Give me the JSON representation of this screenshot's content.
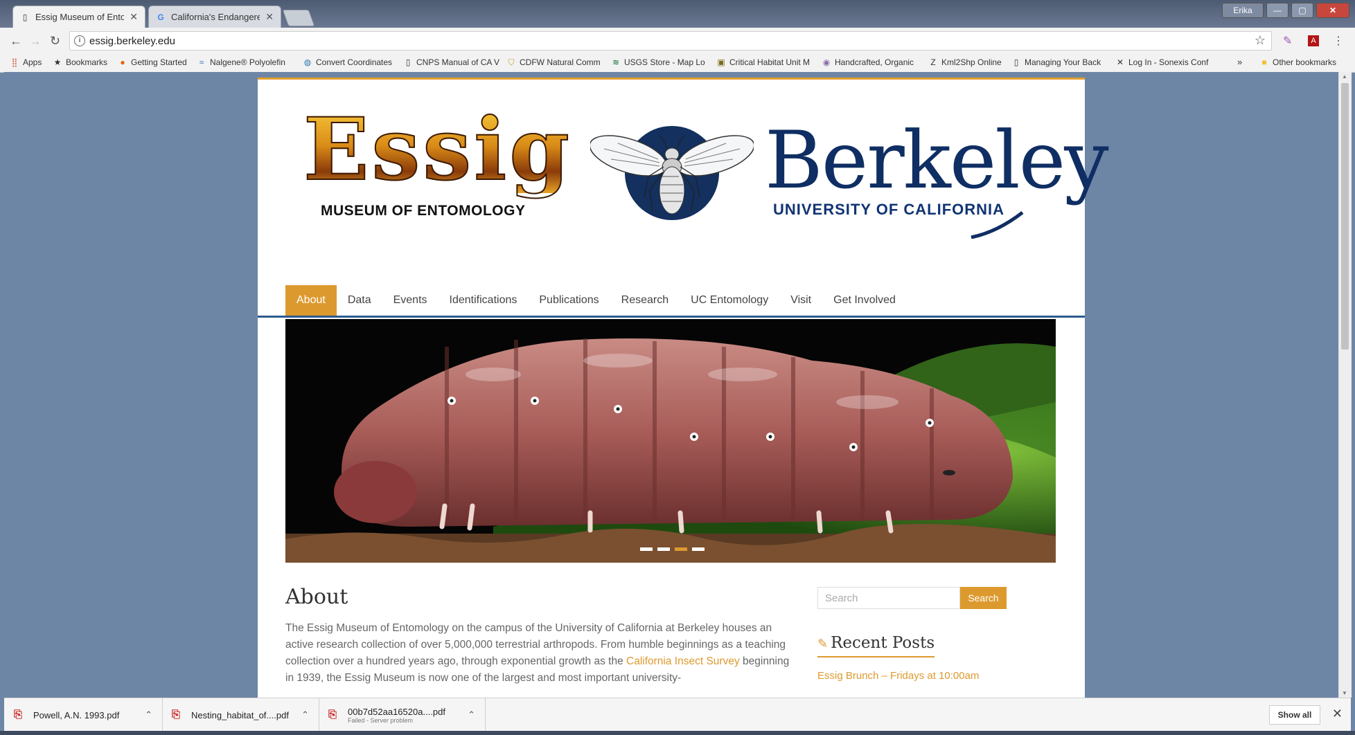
{
  "tabs": [
    {
      "title": "Essig Museum of Entomology",
      "icon": "page-icon",
      "active": true
    },
    {
      "title": "California's Endangered",
      "icon": "google-icon",
      "active": false
    }
  ],
  "window": {
    "user_label": "Erika"
  },
  "address_bar": {
    "url": "essig.berkeley.edu"
  },
  "bookmarks": [
    {
      "label": "Apps",
      "icon": "apps-grid-icon"
    },
    {
      "label": "Bookmarks",
      "icon": "star-icon"
    },
    {
      "label": "Getting Started",
      "icon": "firefox-icon"
    },
    {
      "label": "Nalgene® Polyolefin",
      "icon": "wave-icon"
    },
    {
      "label": "Convert Coordinates",
      "icon": "globe-icon"
    },
    {
      "label": "CNPS Manual of CA V",
      "icon": "page-icon"
    },
    {
      "label": "CDFW Natural Comm",
      "icon": "shield-icon"
    },
    {
      "label": "USGS Store - Map Lo",
      "icon": "usgs-icon"
    },
    {
      "label": "Critical Habitat Unit M",
      "icon": "habitat-icon"
    },
    {
      "label": "Handcrafted, Organic",
      "icon": "circle-icon"
    },
    {
      "label": "Kml2Shp Online",
      "icon": "z-icon"
    },
    {
      "label": "Managing Your Back",
      "icon": "page-icon"
    },
    {
      "label": "Log In - Sonexis Conf",
      "icon": "x-icon"
    }
  ],
  "other_bookmarks": "Other bookmarks",
  "overflow_label": "»",
  "site": {
    "logo": {
      "essig_word": "Essig",
      "essig_sub": "MUSEUM OF ENTOMOLOGY",
      "berkeley_word": "Berkeley",
      "berkeley_sub": "UNIVERSITY OF CALIFORNIA"
    },
    "nav": [
      "About",
      "Data",
      "Events",
      "Identifications",
      "Publications",
      "Research",
      "UC Entomology",
      "Visit",
      "Get Involved"
    ],
    "active_nav": "About",
    "slider": {
      "slide_count": 4,
      "active_index": 2,
      "image_alt": "caterpillar-photo"
    },
    "content": {
      "heading": "About",
      "para_part1": "The Essig Museum of Entomology on the campus of the University of California at Berkeley houses an active research collection of over 5,000,000 terrestrial arthropods. From humble beginnings as a teaching collection over a hundred years ago, through exponential growth as the ",
      "link": "California Insect Survey",
      "para_part2": " beginning in 1939, the Essig Museum is now one of the largest and most important university-"
    },
    "sidebar": {
      "search_placeholder": "Search",
      "search_button": "Search",
      "recent_posts_title": "Recent Posts",
      "recent_post": "Essig Brunch – Fridays at 10:00am"
    }
  },
  "downloads": [
    {
      "name": "Powell, A.N. 1993.pdf",
      "status": ""
    },
    {
      "name": "Nesting_habitat_of....pdf",
      "status": ""
    },
    {
      "name": "00b7d52aa16520a....pdf",
      "status": "Failed - Server problem"
    }
  ],
  "show_all_label": "Show all",
  "colors": {
    "accent": "#dc9a2e",
    "berkeley_blue": "#0f2e63",
    "page_bg": "#6e86a6"
  }
}
